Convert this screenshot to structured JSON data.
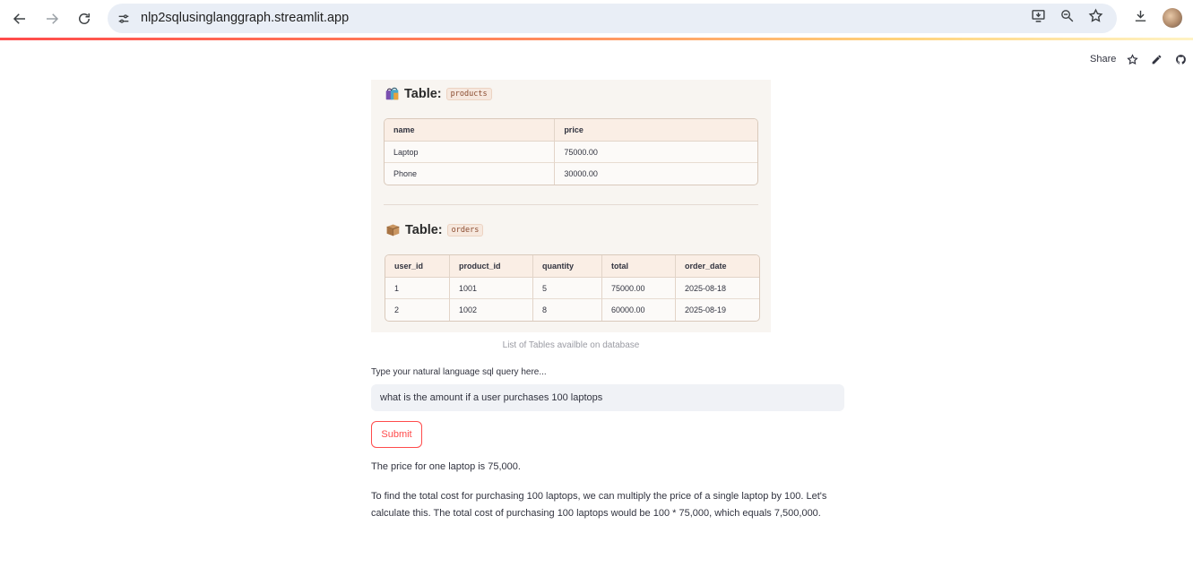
{
  "browser": {
    "url": "nlp2sqlusinglanggraph.streamlit.app",
    "icons": [
      "back-arrow-icon",
      "forward-arrow-icon",
      "reload-icon",
      "site-info-icon",
      "install-app-icon",
      "zoom-icon",
      "bookmark-star-icon",
      "download-icon",
      "profile-avatar"
    ]
  },
  "toolbar": {
    "share_label": "Share",
    "icons": [
      "star-icon",
      "edit-pencil-icon",
      "github-icon"
    ]
  },
  "tables_image": {
    "products": {
      "heading": "Table:",
      "name_chip": "products",
      "emoji": "shopping-bags-icon",
      "columns": [
        "name",
        "price"
      ],
      "rows": [
        [
          "Laptop",
          "75000.00"
        ],
        [
          "Phone",
          "30000.00"
        ]
      ]
    },
    "orders": {
      "heading": "Table:",
      "name_chip": "orders",
      "emoji": "package-box-icon",
      "columns": [
        "user_id",
        "product_id",
        "quantity",
        "total",
        "order_date"
      ],
      "rows": [
        [
          "1",
          "1001",
          "5",
          "75000.00",
          "2025-08-18"
        ],
        [
          "2",
          "1002",
          "8",
          "60000.00",
          "2025-08-19"
        ]
      ]
    },
    "caption": "List of Tables availble on database"
  },
  "query": {
    "label": "Type your natural language sql query here...",
    "value": "what is the amount if a user purchases 100 laptops"
  },
  "submit_label": "Submit",
  "answer": {
    "line1": "The price for one laptop is 75,000.",
    "line2": "To find the total cost for purchasing 100 laptops, we can multiply the price of a single laptop by 100. Let's calculate this. The total cost of purchasing 100 laptops would be 100 * 75,000, which equals 7,500,000."
  },
  "colors": {
    "accent": "#ff4b4b",
    "input_bg": "#f0f2f6",
    "omnibox_bg": "#e9eef6",
    "table_header_bg": "#faeee5"
  }
}
